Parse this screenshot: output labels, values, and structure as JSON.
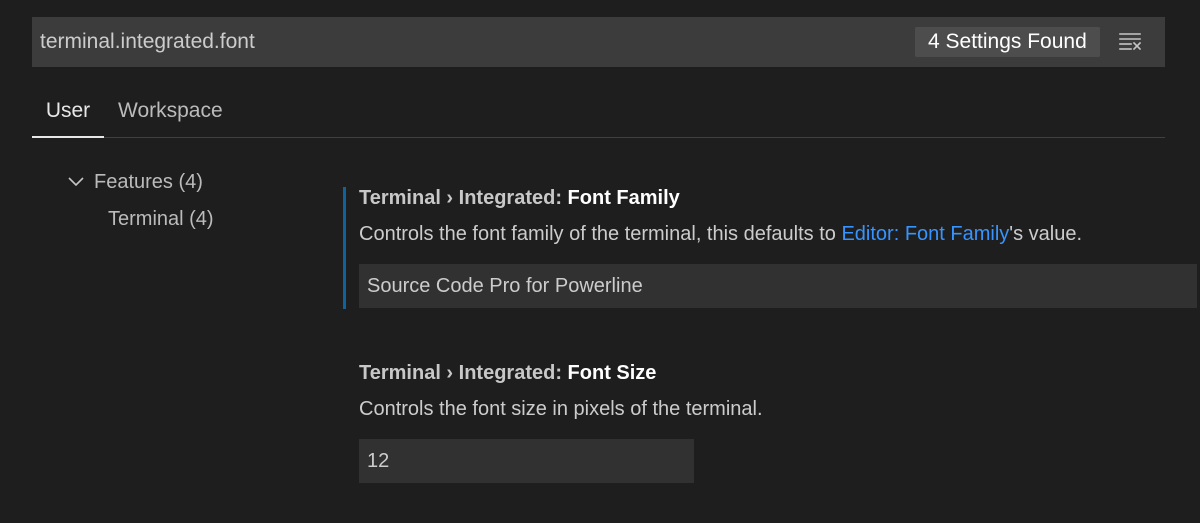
{
  "search": {
    "value": "terminal.integrated.font",
    "results_count": "4 Settings Found"
  },
  "tabs": [
    {
      "label": "User",
      "active": true
    },
    {
      "label": "Workspace",
      "active": false
    }
  ],
  "tree": {
    "features": "Features (4)",
    "terminal": "Terminal (4)"
  },
  "settings": [
    {
      "category": "Terminal › Integrated: ",
      "label": "Font Family",
      "desc_before": "Controls the font family of the terminal, this defaults to ",
      "desc_link": "Editor: Font Family",
      "desc_after": "'s value.",
      "value": "Source Code Pro for Powerline"
    },
    {
      "category": "Terminal › Integrated: ",
      "label": "Font Size",
      "desc": "Controls the font size in pixels of the terminal.",
      "value": "12"
    }
  ],
  "icons": {
    "clear": "clear-filter-icon",
    "chevron": "chevron-down-icon"
  },
  "colors": {
    "background": "#1e1e1e",
    "link": "#3794ff",
    "focus_bar": "#0e639c"
  }
}
